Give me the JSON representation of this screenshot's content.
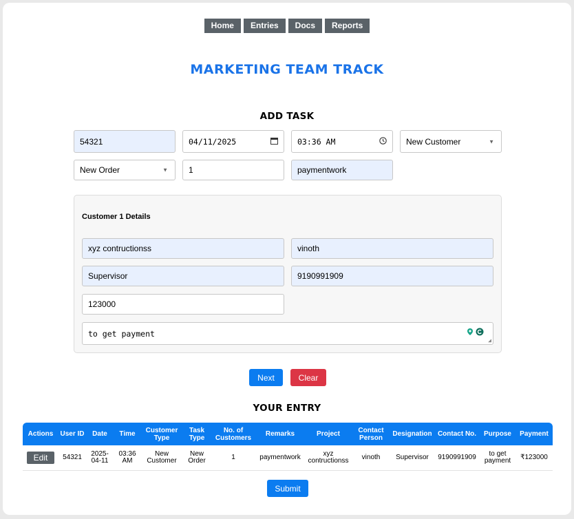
{
  "nav": {
    "items": [
      "Home",
      "Entries",
      "Docs",
      "Reports"
    ]
  },
  "page_title": "MARKETING TEAM TRACK",
  "form": {
    "heading": "ADD TASK",
    "user_id": "54321",
    "date": "04/11/2025",
    "time": "03:36 AM",
    "customer_type": "New Customer",
    "task_type": "New Order",
    "num_customers": "1",
    "remarks": "paymentwork"
  },
  "customer": {
    "heading": "Customer 1 Details",
    "project": "xyz contructionss",
    "contact_person": "vinoth",
    "designation": "Supervisor",
    "contact_no": "9190991909",
    "payment": "123000",
    "purpose": "to get payment"
  },
  "buttons": {
    "next": "Next",
    "clear": "Clear",
    "submit": "Submit",
    "edit": "Edit"
  },
  "entries": {
    "heading": "YOUR ENTRY",
    "columns": [
      "Actions",
      "User ID",
      "Date",
      "Time",
      "Customer Type",
      "Task Type",
      "No. of Customers",
      "Remarks",
      "Project",
      "Contact Person",
      "Designation",
      "Contact No.",
      "Purpose",
      "Payment"
    ],
    "rows": [
      [
        "Edit",
        "54321",
        "2025-04-11",
        "03:36 AM",
        "New Customer",
        "New Order",
        "1",
        "paymentwork",
        "xyz contructionss",
        "vinoth",
        "Supervisor",
        "9190991909",
        "to get payment",
        "₹123000"
      ]
    ]
  },
  "colors": {
    "accent": "#1a73e8",
    "primary_button": "#0b7cf0",
    "danger_button": "#dc3545",
    "nav_button": "#5a6268"
  }
}
